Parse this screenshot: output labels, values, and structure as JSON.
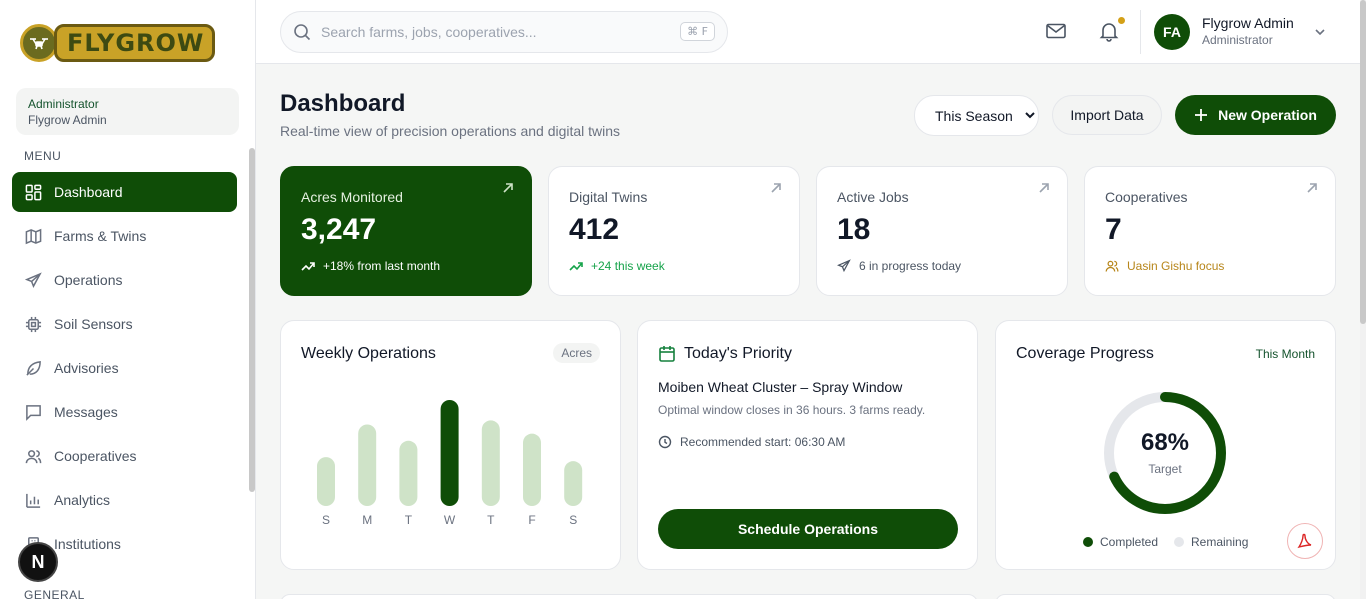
{
  "brand": {
    "name": "FLYGROW"
  },
  "user_card": {
    "role": "Administrator",
    "name": "Flygrow Admin"
  },
  "sidebar": {
    "menu_title": "MENU",
    "general_title": "GENERAL",
    "items": [
      {
        "label": "Dashboard",
        "icon": "dashboard-icon",
        "active": true
      },
      {
        "label": "Farms & Twins",
        "icon": "map-icon"
      },
      {
        "label": "Operations",
        "icon": "plane-icon"
      },
      {
        "label": "Soil Sensors",
        "icon": "chip-icon"
      },
      {
        "label": "Advisories",
        "icon": "leaf-icon"
      },
      {
        "label": "Messages",
        "icon": "message-icon"
      },
      {
        "label": "Cooperatives",
        "icon": "users-icon"
      },
      {
        "label": "Analytics",
        "icon": "bar-chart-icon"
      },
      {
        "label": "Institutions",
        "icon": "building-icon"
      }
    ]
  },
  "topbar": {
    "search_placeholder": "Search farms, jobs, cooperatives...",
    "search_shortcut": "⌘ F",
    "avatar_initials": "FA",
    "profile_name": "Flygrow Admin",
    "profile_role": "Administrator"
  },
  "header": {
    "title": "Dashboard",
    "subtitle": "Real-time view of precision operations and digital twins",
    "season_options": [
      "This Season"
    ],
    "season_selected": "This Season",
    "import_label": "Import Data",
    "new_op_label": "New Operation"
  },
  "stats": [
    {
      "label": "Acres Monitored",
      "value": "3,247",
      "foot": "+18% from last month",
      "foot_color": "#ffffff"
    },
    {
      "label": "Digital Twins",
      "value": "412",
      "foot": "+24 this week",
      "foot_color": "#16a34a"
    },
    {
      "label": "Active Jobs",
      "value": "18",
      "foot": "6 in progress today",
      "foot_color": "#4b5563"
    },
    {
      "label": "Cooperatives",
      "value": "7",
      "foot": "Uasin Gishu focus",
      "foot_color": "#b7861b"
    }
  ],
  "weekly": {
    "title": "Weekly Operations",
    "unit_pill": "Acres",
    "chart_data": {
      "type": "bar",
      "categories": [
        "S",
        "M",
        "T",
        "W",
        "T",
        "F",
        "S"
      ],
      "values": [
        48,
        80,
        64,
        104,
        84,
        71,
        44
      ],
      "highlight_index": 3,
      "colors": {
        "normal": "#cfe3c8",
        "highlight": "#0f4d07"
      }
    }
  },
  "priority": {
    "title": "Today's Priority",
    "headline": "Moiben Wheat Cluster – Spray Window",
    "description": "Optimal window closes in 36 hours. 3 farms ready.",
    "recommended": "Recommended start: 06:30 AM",
    "button": "Schedule Operations"
  },
  "coverage": {
    "title": "Coverage Progress",
    "period": "This Month",
    "value": "68%",
    "percent": 68,
    "label": "Target",
    "legend": [
      {
        "label": "Completed",
        "color": "#0f4d07"
      },
      {
        "label": "Remaining",
        "color": "#e5e7eb"
      }
    ]
  },
  "fab": {
    "label": "N"
  }
}
